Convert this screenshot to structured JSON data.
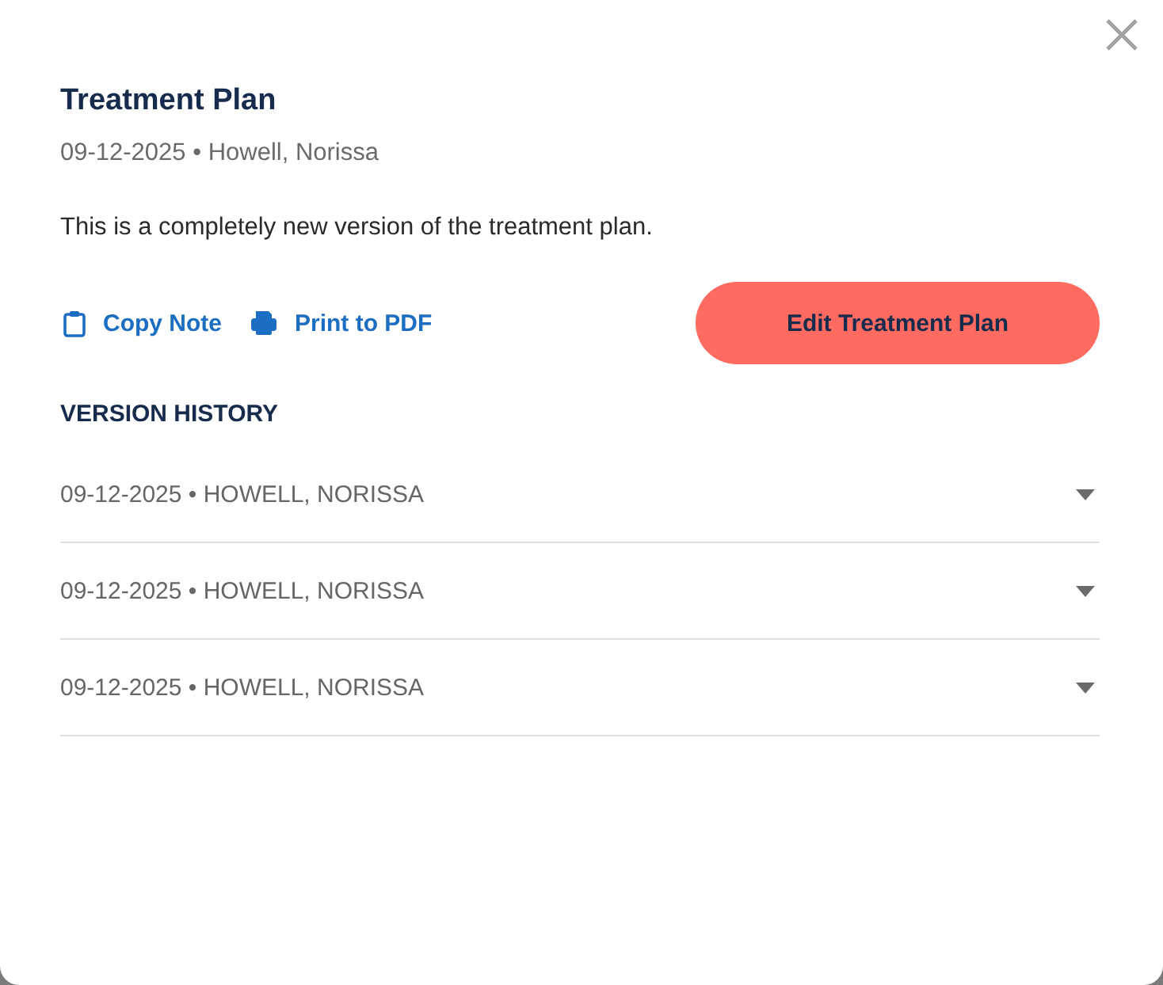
{
  "dialog": {
    "title": "Treatment Plan",
    "subtitle": "09-12-2025 • Howell, Norissa",
    "description": "This is a completely new version of the treatment plan."
  },
  "actions": [
    {
      "kind": "copy",
      "label": "Copy Note"
    },
    {
      "kind": "print",
      "label": "Print to PDF"
    }
  ],
  "primary_button": {
    "label": "Edit Treatment Plan"
  },
  "version_history": {
    "heading": "VERSION HISTORY",
    "items": [
      {
        "label": "09-12-2025 • HOWELL, NORISSA",
        "expanded": false
      },
      {
        "label": "09-12-2025 • HOWELL, NORISSA",
        "expanded": false
      },
      {
        "label": "09-12-2025 • HOWELL, NORISSA",
        "expanded": false
      }
    ]
  }
}
